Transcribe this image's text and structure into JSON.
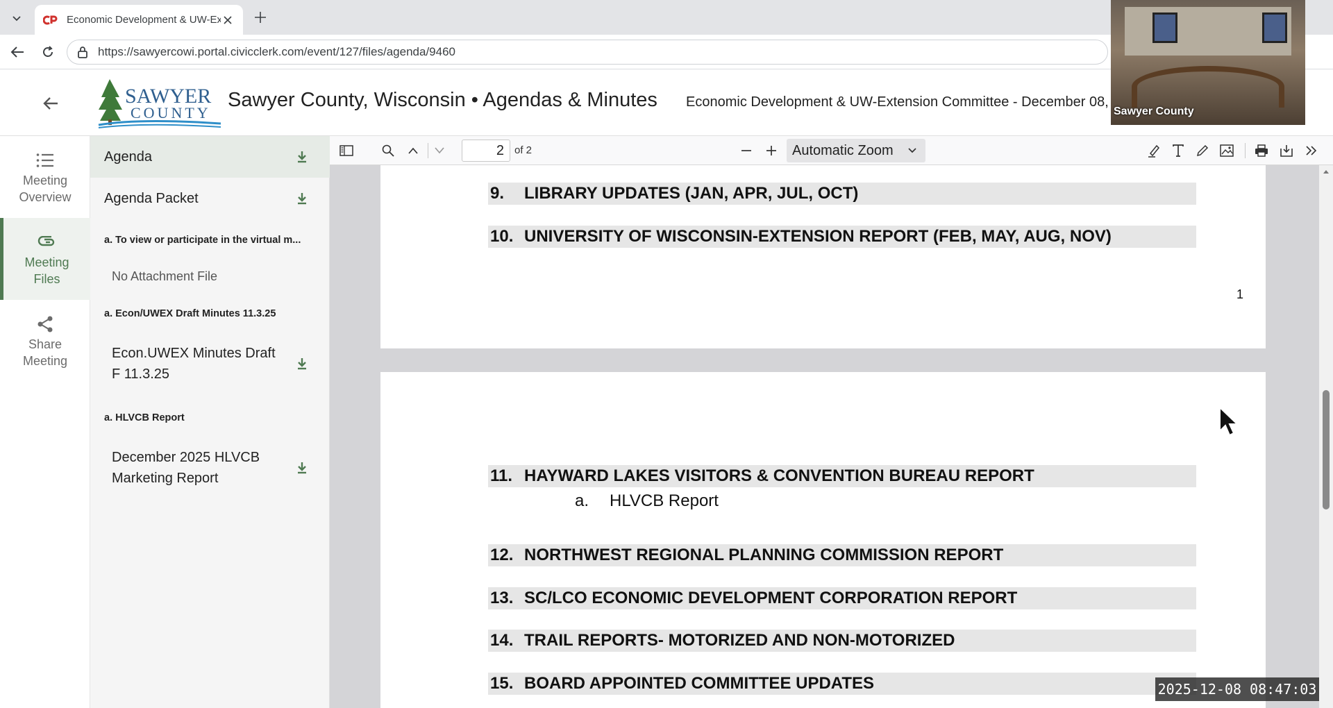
{
  "browser": {
    "tab_title": "Economic Development & UW-Ext",
    "url": "https://sawyercowi.portal.civicclerk.com/event/127/files/agenda/9460"
  },
  "header": {
    "logo_line1": "SAWYER",
    "logo_line2": "COUNTY",
    "site_title": "Sawyer County, Wisconsin • Agendas & Minutes",
    "meeting_title": "Economic Development & UW-Extension Committee - December 08,"
  },
  "webcam": {
    "label": "Sawyer County"
  },
  "rail": {
    "items": [
      {
        "label": "Meeting Overview",
        "icon": "list-icon"
      },
      {
        "label": "Meeting Files",
        "icon": "paperclip-icon",
        "active": true
      },
      {
        "label": "Share Meeting",
        "icon": "share-icon"
      }
    ],
    "overview_line1": "Meeting",
    "overview_line2": "Overview",
    "files_line1": "Meeting",
    "files_line2": "Files",
    "share_line1": "Share",
    "share_line2": "Meeting"
  },
  "files": {
    "agenda": "Agenda",
    "agenda_packet": "Agenda Packet",
    "section_virtual": "a. To view or participate in the virtual m...",
    "no_attachment": "No Attachment File",
    "section_minutes": "a. Econ/UWEX Draft Minutes 11.3.25",
    "minutes_file_line1": "Econ.UWEX Minutes Draft",
    "minutes_file_line2": "F 11.3.25",
    "section_hlvcb": "a. HLVCB Report",
    "hlvcb_file_line1": "December 2025 HLVCB",
    "hlvcb_file_line2": "Marketing Report"
  },
  "pdf_toolbar": {
    "page_current": "2",
    "page_of": "of 2",
    "zoom": "Automatic Zoom"
  },
  "pdf": {
    "page1_items": [
      {
        "num": "9.",
        "text": "LIBRARY UPDATES (JAN, APR, JUL, OCT)"
      },
      {
        "num": "10.",
        "text": "UNIVERSITY OF WISCONSIN-EXTENSION REPORT (FEB, MAY, AUG, NOV)"
      }
    ],
    "page1_number": "1",
    "page2_items": [
      {
        "num": "11.",
        "text": "HAYWARD LAKES VISITORS & CONVENTION BUREAU REPORT"
      },
      {
        "num": "12.",
        "text": "NORTHWEST REGIONAL PLANNING COMMISSION REPORT"
      },
      {
        "num": "13.",
        "text": "SC/LCO ECONOMIC DEVELOPMENT CORPORATION REPORT"
      },
      {
        "num": "14.",
        "text": "TRAIL REPORTS- MOTORIZED AND NON-MOTORIZED"
      },
      {
        "num": "15.",
        "text": "BOARD APPOINTED COMMITTEE UPDATES"
      }
    ],
    "sub_11a_letter": "a.",
    "sub_11a_text": "HLVCB Report"
  },
  "overlay": {
    "timestamp": "2025-12-08  08:47:03"
  },
  "colors": {
    "accent_green": "#4f7a52",
    "agenda_bar": "#e6e6e6",
    "pdf_background": "#d4d4d7"
  }
}
